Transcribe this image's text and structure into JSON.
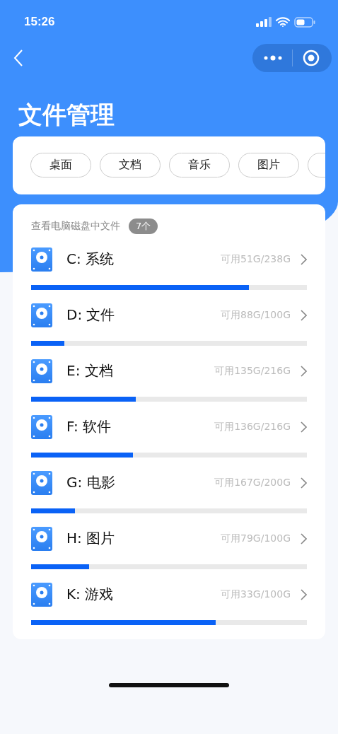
{
  "status_bar": {
    "time": "15:26"
  },
  "page": {
    "title": "文件管理"
  },
  "tabs": [
    {
      "label": "桌面"
    },
    {
      "label": "文档"
    },
    {
      "label": "音乐"
    },
    {
      "label": "图片"
    }
  ],
  "disk_list": {
    "heading": "查看电脑磁盘中文件",
    "count": "7个"
  },
  "disks": [
    {
      "name": "C: 系统",
      "space": "可用51G/238G",
      "level": 0.79
    },
    {
      "name": "D: 文件",
      "space": "可用88G/100G",
      "level": 0.12
    },
    {
      "name": "E: 文档",
      "space": "可用135G/216G",
      "level": 0.38
    },
    {
      "name": "F: 软件",
      "space": "可用136G/216G",
      "level": 0.37
    },
    {
      "name": "G: 电影",
      "space": "可用167G/200G",
      "level": 0.16
    },
    {
      "name": "H: 图片",
      "space": "可用79G/100G",
      "level": 0.21
    },
    {
      "name": "K: 游戏",
      "space": "可用33G/100G",
      "level": 0.67
    }
  ]
}
